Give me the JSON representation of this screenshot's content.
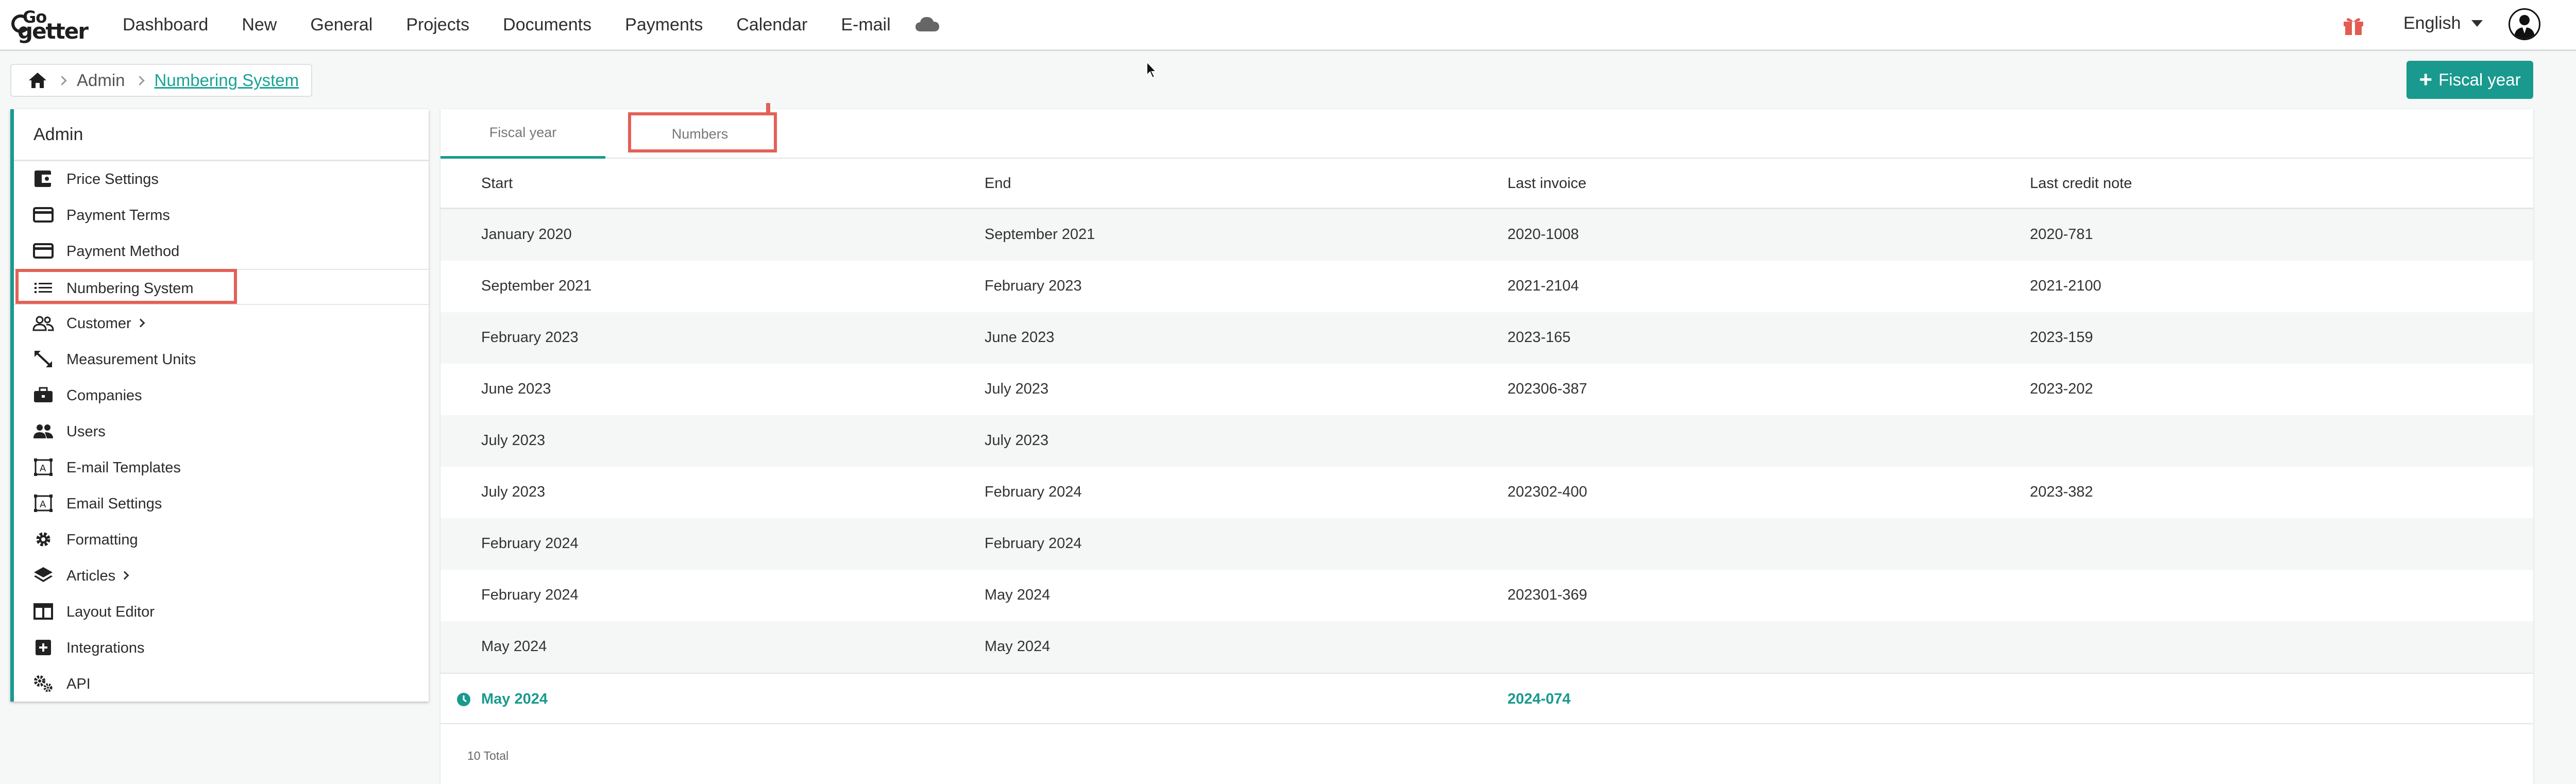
{
  "brand": {
    "line1": "Go",
    "line2": "getter"
  },
  "nav": {
    "items": [
      {
        "label": "Dashboard"
      },
      {
        "label": "New"
      },
      {
        "label": "General"
      },
      {
        "label": "Projects"
      },
      {
        "label": "Documents"
      },
      {
        "label": "Payments"
      },
      {
        "label": "Calendar"
      },
      {
        "label": "E-mail"
      }
    ],
    "cloud_icon": "cloud-icon",
    "gift_icon": "gift-icon",
    "language": "English"
  },
  "breadcrumb": {
    "home_icon": "home-icon",
    "level1": "Admin",
    "current": "Numbering System"
  },
  "actions": {
    "add_fiscal_year": "Fiscal year"
  },
  "sidebar": {
    "title": "Admin",
    "items": [
      {
        "label": "Price Settings",
        "icon": "price-tag-icon"
      },
      {
        "label": "Payment Terms",
        "icon": "credit-card-icon"
      },
      {
        "label": "Payment Method",
        "icon": "credit-card-icon"
      },
      {
        "label": "Numbering System",
        "icon": "list-icon",
        "active": true
      },
      {
        "label": "Customer",
        "icon": "people-icon",
        "submenu": true
      },
      {
        "label": "Measurement Units",
        "icon": "resize-icon"
      },
      {
        "label": "Companies",
        "icon": "briefcase-icon"
      },
      {
        "label": "Users",
        "icon": "users-icon"
      },
      {
        "label": "E-mail Templates",
        "icon": "template-icon"
      },
      {
        "label": "Email Settings",
        "icon": "template-icon"
      },
      {
        "label": "Formatting",
        "icon": "gear-icon"
      },
      {
        "label": "Articles",
        "icon": "layers-icon",
        "submenu": true
      },
      {
        "label": "Layout Editor",
        "icon": "layout-icon"
      },
      {
        "label": "Integrations",
        "icon": "plus-box-icon"
      },
      {
        "label": "API",
        "icon": "gears-icon"
      }
    ]
  },
  "tabs": {
    "fiscal_year": "Fiscal year",
    "numbers": "Numbers"
  },
  "table": {
    "columns": [
      "Start",
      "End",
      "Last invoice",
      "Last credit note"
    ],
    "rows": [
      [
        "January 2020",
        "September 2021",
        "2020-1008",
        "2020-781"
      ],
      [
        "September 2021",
        "February 2023",
        "2021-2104",
        "2021-2100"
      ],
      [
        "February 2023",
        "June 2023",
        "2023-165",
        "2023-159"
      ],
      [
        "June 2023",
        "July 2023",
        "202306-387",
        "2023-202"
      ],
      [
        "July 2023",
        "July 2023",
        "",
        ""
      ],
      [
        "July 2023",
        "February 2024",
        "202302-400",
        "2023-382"
      ],
      [
        "February 2024",
        "February 2024",
        "",
        ""
      ],
      [
        "February 2024",
        "May 2024",
        "202301-369",
        ""
      ],
      [
        "May 2024",
        "May 2024",
        "",
        ""
      ],
      [
        "May 2024",
        "",
        "2024-074",
        ""
      ]
    ],
    "current_row_index": 9,
    "total": "10 Total"
  },
  "colors": {
    "accent": "#1a9a8e",
    "highlight": "#e26158"
  }
}
